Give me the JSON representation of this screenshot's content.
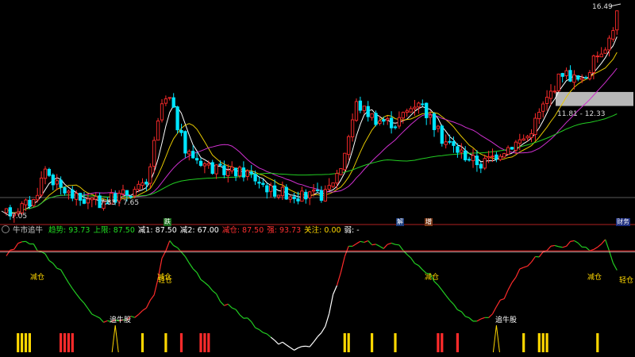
{
  "chart_data": [
    {
      "type": "candlestick",
      "panel": "main",
      "y_scale": [
        7.0,
        16.8
      ],
      "annotations": {
        "high_label": "16.49",
        "low_label": "7.05",
        "range_label_1": "7.83 - 7.65",
        "range_label_2": "11.81 - 12.33"
      },
      "colors": {
        "up": "#ff2b2b",
        "down": "#00e5ff",
        "ma_white": "#ffffff",
        "ma_yellow": "#e6c800",
        "ma_magenta": "#d030d0",
        "ma_green": "#22cc22",
        "zone_band": "#d8d8d8"
      }
    },
    {
      "type": "line",
      "panel": "indicator",
      "title": "牛市追牛",
      "levels": {
        "upper": 87.5
      },
      "annotations": [
        "减仓",
        "减仓",
        "轻仓",
        "减仓",
        "减仓",
        "轻仓",
        "追牛股",
        "追牛股"
      ]
    }
  ],
  "indicator_header": {
    "name": "牛市追牛",
    "items": [
      {
        "label": "趋势:",
        "value": "93.73",
        "color": "#22dd22"
      },
      {
        "label": "上限:",
        "value": "87.50",
        "color": "#22dd22"
      },
      {
        "label": "减1:",
        "value": "87.50",
        "color": "#ffffff"
      },
      {
        "label": "减2:",
        "value": "67.00",
        "color": "#ffffff"
      },
      {
        "label": "减仓:",
        "value": "87.50",
        "color": "#ff3030"
      },
      {
        "label": "强:",
        "value": "93.73",
        "color": "#ff3030"
      },
      {
        "label": "关注:",
        "value": "0.00",
        "color": "#ffd700"
      },
      {
        "label": "弱:",
        "value": "-",
        "color": "#ffffff"
      }
    ]
  },
  "badges": {
    "b1": "跌",
    "b2": "解",
    "b3": "增",
    "b4": "财务"
  }
}
